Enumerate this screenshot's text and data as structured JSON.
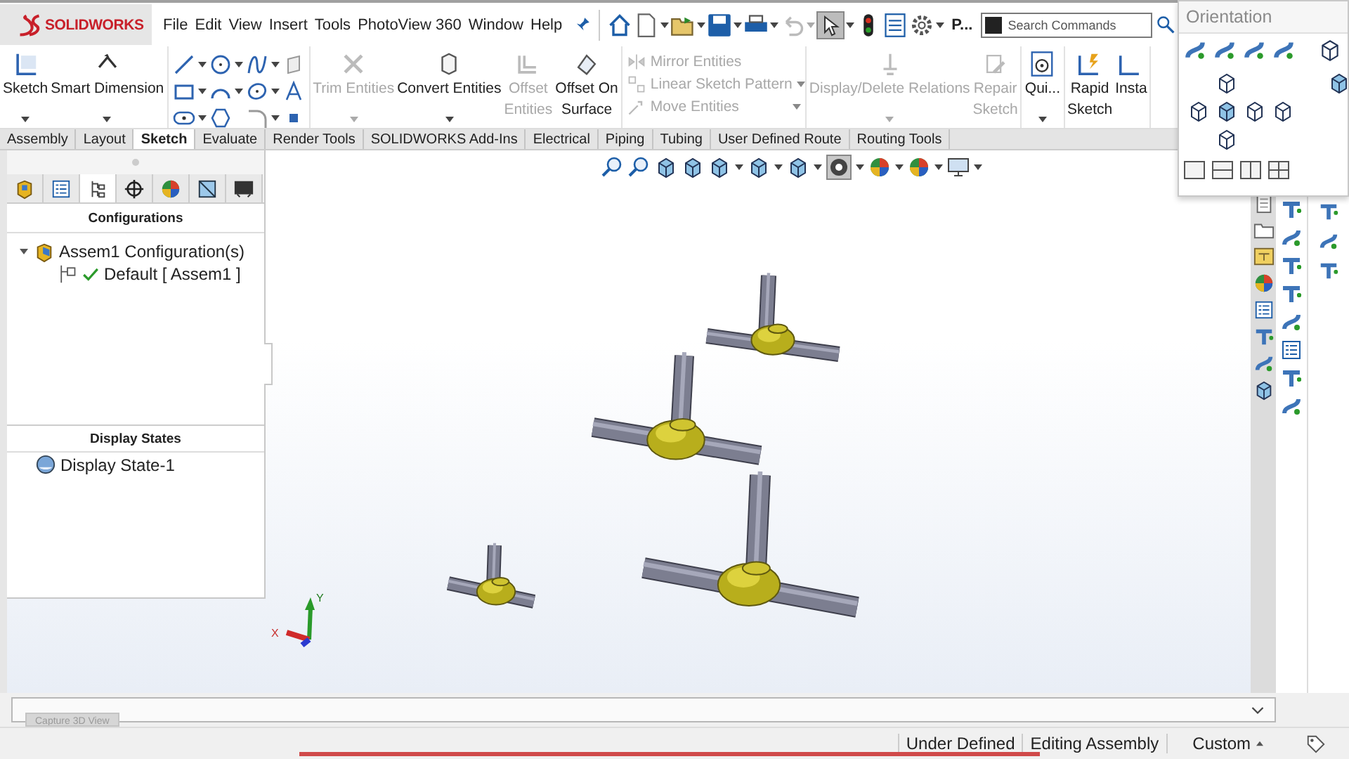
{
  "menu": {
    "logo": "SOLIDWORKS",
    "items": [
      "File",
      "Edit",
      "View",
      "Insert",
      "Tools",
      "PhotoView 360",
      "Window",
      "Help"
    ],
    "overflow": "P...",
    "search": {
      "placeholder": "Search Commands"
    }
  },
  "ribbon": [
    {
      "kind": "large",
      "items": [
        {
          "label": "Sketch",
          "disabled": false,
          "dropdown": true
        },
        {
          "label": "Smart Dimension",
          "disabled": false,
          "dropdown": true
        }
      ]
    },
    {
      "kind": "grid"
    },
    {
      "kind": "large",
      "items": [
        {
          "label": "Trim Entities",
          "disabled": true,
          "dropdown": true
        },
        {
          "label": "Convert Entities",
          "disabled": false,
          "dropdown": true
        },
        {
          "label": "Offset\nEntities",
          "disabled": true,
          "dropdown": false
        },
        {
          "label": "Offset On\nSurface",
          "disabled": false,
          "dropdown": false
        }
      ]
    },
    {
      "kind": "stack",
      "items": [
        {
          "label": "Mirror Entities",
          "disabled": true,
          "dropdown": false
        },
        {
          "label": "Linear Sketch Pattern",
          "disabled": true,
          "dropdown": true
        },
        {
          "label": "Move Entities",
          "disabled": true,
          "dropdown": true
        }
      ]
    },
    {
      "kind": "large",
      "items": [
        {
          "label": "Display/Delete Relations",
          "disabled": true,
          "dropdown": true
        },
        {
          "label": "Repair\nSketch",
          "disabled": true,
          "dropdown": false
        }
      ]
    },
    {
      "kind": "large",
      "items": [
        {
          "label": "Qui...",
          "disabled": false,
          "dropdown": true
        }
      ]
    },
    {
      "kind": "large",
      "items": [
        {
          "label": "Rapid\nSketch",
          "disabled": false,
          "dropdown": false
        },
        {
          "label": "Insta",
          "disabled": false,
          "dropdown": false
        }
      ]
    }
  ],
  "tabs": [
    {
      "label": "Assembly",
      "selected": false
    },
    {
      "label": "Layout",
      "selected": false
    },
    {
      "label": "Sketch",
      "selected": true
    },
    {
      "label": "Evaluate",
      "selected": false
    },
    {
      "label": "Render Tools",
      "selected": false
    },
    {
      "label": "SOLIDWORKS Add-Ins",
      "selected": false
    },
    {
      "label": "Electrical",
      "selected": false
    },
    {
      "label": "Piping",
      "selected": false
    },
    {
      "label": "Tubing",
      "selected": false
    },
    {
      "label": "User Defined Route",
      "selected": false
    },
    {
      "label": "Routing Tools",
      "selected": false
    }
  ],
  "panel": {
    "tabs": [
      {
        "selected": false
      },
      {
        "selected": false
      },
      {
        "selected": true
      },
      {
        "selected": false
      },
      {
        "selected": false
      },
      {
        "selected": false
      },
      {
        "selected": false
      }
    ],
    "configurations": {
      "title": "Configurations",
      "tree": [
        {
          "label": "Assem1 Configuration(s)",
          "expanded": true,
          "children": [
            {
              "label": "Default [ Assem1 ]",
              "active": true
            }
          ]
        }
      ]
    },
    "display_states": {
      "title": "Display States",
      "items": [
        "Display State-1"
      ]
    }
  },
  "triad": {
    "x": "X",
    "y": "Y"
  },
  "orientation": {
    "title": "Orientation"
  },
  "bottom_bar": {
    "button": "Capture 3D View"
  },
  "status_bar": [
    {
      "label": "Under Defined",
      "dropdown": false
    },
    {
      "label": "Editing Assembly",
      "dropdown": false
    },
    {
      "label": "Custom",
      "dropdown": true
    }
  ]
}
